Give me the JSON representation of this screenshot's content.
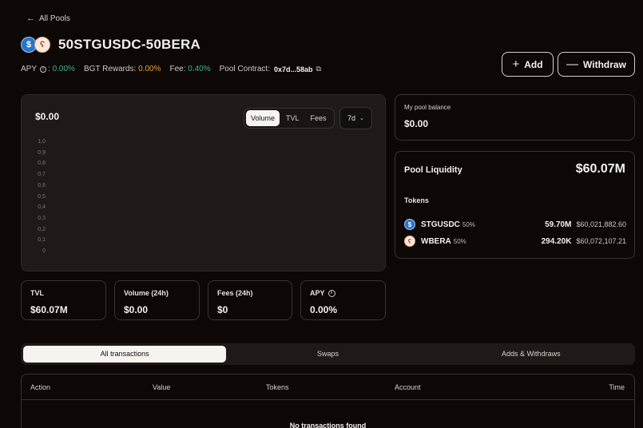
{
  "nav": {
    "back_label": "All Pools"
  },
  "pool": {
    "name": "50STGUSDC-50BERA",
    "apy_label": "APY",
    "apy_value": "0.00%",
    "bgt_label": "BGT Rewards:",
    "bgt_value": "0.00%",
    "fee_label": "Fee:",
    "fee_value": "0.40%",
    "contract_label": "Pool Contract:",
    "contract_value": "0x7d...58ab"
  },
  "actions": {
    "add_label": "Add",
    "withdraw_label": "Withdraw"
  },
  "chart": {
    "value": "$0.00",
    "tabs": [
      "Volume",
      "TVL",
      "Fees"
    ],
    "active_tab": "Volume",
    "range": "7d",
    "y_ticks": [
      "1,0",
      "0,9",
      "0,8",
      "0,7",
      "0,6",
      "0,5",
      "0,4",
      "0,3",
      "0,2",
      "0,1",
      "0"
    ]
  },
  "stats": [
    {
      "label": "TVL",
      "value": "$60.07M"
    },
    {
      "label": "Volume (24h)",
      "value": "$0.00"
    },
    {
      "label": "Fees (24h)",
      "value": "$0"
    },
    {
      "label": "APY",
      "value": "0.00%"
    }
  ],
  "balance": {
    "label": "My pool balance",
    "value": "$0.00"
  },
  "liquidity": {
    "title": "Pool Liquidity",
    "total": "$60.07M",
    "tokens_label": "Tokens",
    "tokens": [
      {
        "name": "STGUSDC",
        "weight": "50%",
        "amount": "59.70M",
        "usd": "$60,021,882.60",
        "icon": "stgusdc-icon"
      },
      {
        "name": "WBERA",
        "weight": "50%",
        "amount": "294.20K",
        "usd": "$60,072,107.21",
        "icon": "wbera-icon"
      }
    ]
  },
  "transactions": {
    "tabs": [
      "All transactions",
      "Swaps",
      "Adds & Withdraws"
    ],
    "active_tab": "All transactions",
    "columns": [
      "Action",
      "Value",
      "Tokens",
      "Account",
      "Time"
    ],
    "empty_message": "No transactions found"
  },
  "colors": {
    "positive": "#3fb68b",
    "warning": "#e8a23d",
    "background": "#0d0806"
  }
}
